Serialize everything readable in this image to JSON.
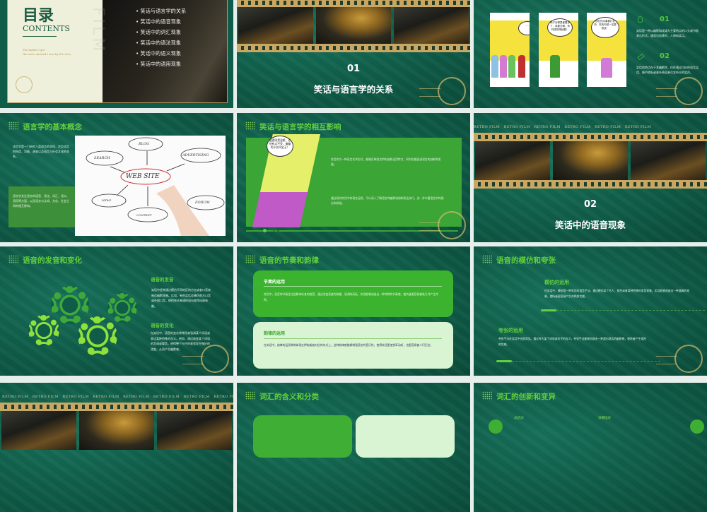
{
  "slides": [
    {
      "id": "contents",
      "title_cn": "目录",
      "title_en": "CONTENTS",
      "quote_1": "The higher I got",
      "quote_2": "the more amazed I was by the view.",
      "watermark": "FILM",
      "items": [
        "笑话与语言学的关系",
        "笑话中的语音现象",
        "笑话中的词汇现象",
        "笑话中的语法现象",
        "笑话中的语义现象",
        "笑话中的语用现象"
      ]
    },
    {
      "id": "section-01",
      "number": "01",
      "title": "笑话与语言学的关系"
    },
    {
      "id": "joke-intro",
      "bubbles": [
        "…",
        "鸭子去哪里都要多了，我要去哪，有时候觉得就要！",
        "现在的水果都打农药，吃的时候一定要削皮！"
      ],
      "points": [
        {
          "number": "01",
          "text": "笑话是一种以幽默和戏谑为主要特点的口头或书面表达形式，通常包括情节、人物和笑点。"
        },
        {
          "number": "02",
          "text": "笑话的特点在于其幽默性，往往通过巧妙的语言运用、情节转折或意外结局来引发听众的笑声。"
        }
      ]
    },
    {
      "id": "linguistics-basics",
      "title": "语言学的基本概念",
      "para_1": "语言学是一门研究人类语言的学科，涉及语言的构造、功能、演变以及语言与社会文化的关系。",
      "para_2": "语言学关注语言的语音、语法、词汇、语义、语用等方面，以及语言与认知、文化、社会之间的相互影响。",
      "diagram": {
        "center": "WEB SITE",
        "nodes": [
          "BLOG",
          "SEARCH",
          "ADVERTISING",
          "NEWS",
          "FORUM",
          "CONTENT"
        ]
      }
    },
    {
      "id": "mutual-influence",
      "title": "笑话与语言学的相互影响",
      "bubble": "温婆则是温柔，恐怕有点不妥，偏偏的小名叫宝玉！",
      "para_1": "笑话作为一种语言艺术形式，能够反映语言的构造和运用特点，同时也能促进语言的创新和发展。",
      "para_2": "通过研究笑话中的语言运用，可以深入了解语言的幽默机制和表达技巧，进一步丰富语言学的理论和实践。"
    },
    {
      "id": "section-02",
      "retro": "RETRO FILM",
      "number": "02",
      "title": "笑话中的语音现象"
    },
    {
      "id": "pronunciation",
      "title": "语音的发音和变化",
      "h1": "语音的发音",
      "p1": "笑话中经常通过模仿不同地区的方言或者口音来制造幽默效果。比如，有些笑话会模仿南方口音或外国口音，使得原本普通的语句变得诙谐有趣。",
      "h2": "语音的变化",
      "p2": "在笑话中，语音的变化常常用来强调某个词语或表达某种特殊的含义。例如，通过改变某个词语的音调或重音，使得整个句子的意思发生微妙的改变，从而产生幽默感。"
    },
    {
      "id": "rhythm",
      "title": "语音的节奏和韵律",
      "card_1_title": "节奏的运用",
      "card_1_text": "笑话中，语音的节奏往往会影响听者的感受。通过改变语速的快慢、语调的高低，笑话能够创造出一种特殊的节奏感，使听者更容易被吸引并产生共鸣。",
      "card_2_title": "韵律的运用",
      "card_2_text": "在笑话中，韵律的运用常常体现在押韵或者对仗的句式上。这种韵律感能够增强语言的音乐性，使得笑话更加悦耳动听，也更容易被人们记住。"
    },
    {
      "id": "imitation",
      "title": "语音的模仿和夸张",
      "h1": "模仿的运用",
      "p1": "在笑话中，模仿是一种常见的语音手法。通过模仿某个名人、角色或者某种特殊的语音现象，笑话能够创造出一种逼真的效果，使听者更容易产生共鸣和笑感。",
      "h2": "夸张的运用",
      "p2": "夸张手法在笑话中也很常见。通过夸大某个词语或句子的含义，夸张手法能够创造出一种超出现实的幽默感，使听者产生强烈的笑感。"
    },
    {
      "id": "film-strip",
      "retro": "RETRO FILM"
    },
    {
      "id": "vocab-meaning",
      "title": "词汇的含义和分类"
    },
    {
      "id": "vocab-innovation",
      "title": "词汇的创新和变异",
      "label_1": "总结词",
      "label_2": "详细描述"
    }
  ]
}
